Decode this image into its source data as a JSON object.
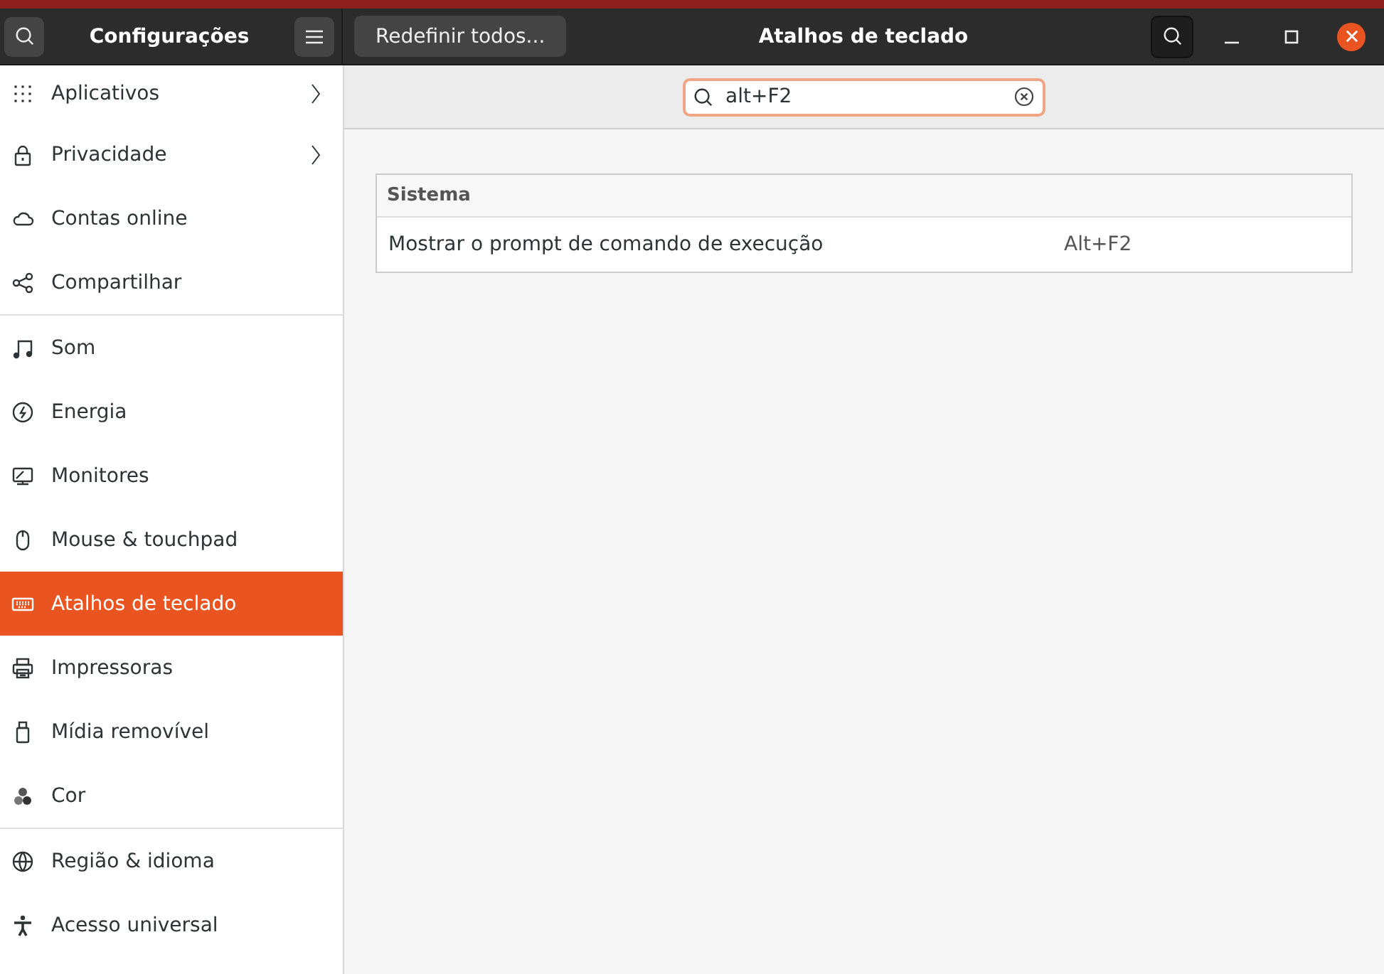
{
  "sidebar": {
    "title": "Configurações",
    "groups": [
      [
        {
          "label": "Aplicativos",
          "submenu": true,
          "selected": false
        },
        {
          "label": "Privacidade",
          "submenu": true,
          "selected": false
        },
        {
          "label": "Contas online",
          "submenu": false,
          "selected": false
        },
        {
          "label": "Compartilhar",
          "submenu": false,
          "selected": false
        }
      ],
      [
        {
          "label": "Som",
          "submenu": false,
          "selected": false
        },
        {
          "label": "Energia",
          "submenu": false,
          "selected": false
        },
        {
          "label": "Monitores",
          "submenu": false,
          "selected": false
        },
        {
          "label": "Mouse & touchpad",
          "submenu": false,
          "selected": false
        },
        {
          "label": "Atalhos de teclado",
          "submenu": false,
          "selected": true
        },
        {
          "label": "Impressoras",
          "submenu": false,
          "selected": false
        },
        {
          "label": "Mídia removível",
          "submenu": false,
          "selected": false
        },
        {
          "label": "Cor",
          "submenu": false,
          "selected": false
        }
      ],
      [
        {
          "label": "Região & idioma",
          "submenu": false,
          "selected": false
        },
        {
          "label": "Acesso universal",
          "submenu": false,
          "selected": false
        }
      ]
    ]
  },
  "header": {
    "reset_button": "Redefinir todos...",
    "title": "Atalhos de teclado"
  },
  "search": {
    "value": "alt+F2"
  },
  "shortcuts": {
    "section": "Sistema",
    "rows": [
      {
        "action": "Mostrar o prompt de comando de execução",
        "keys": "Alt+F2"
      }
    ]
  }
}
